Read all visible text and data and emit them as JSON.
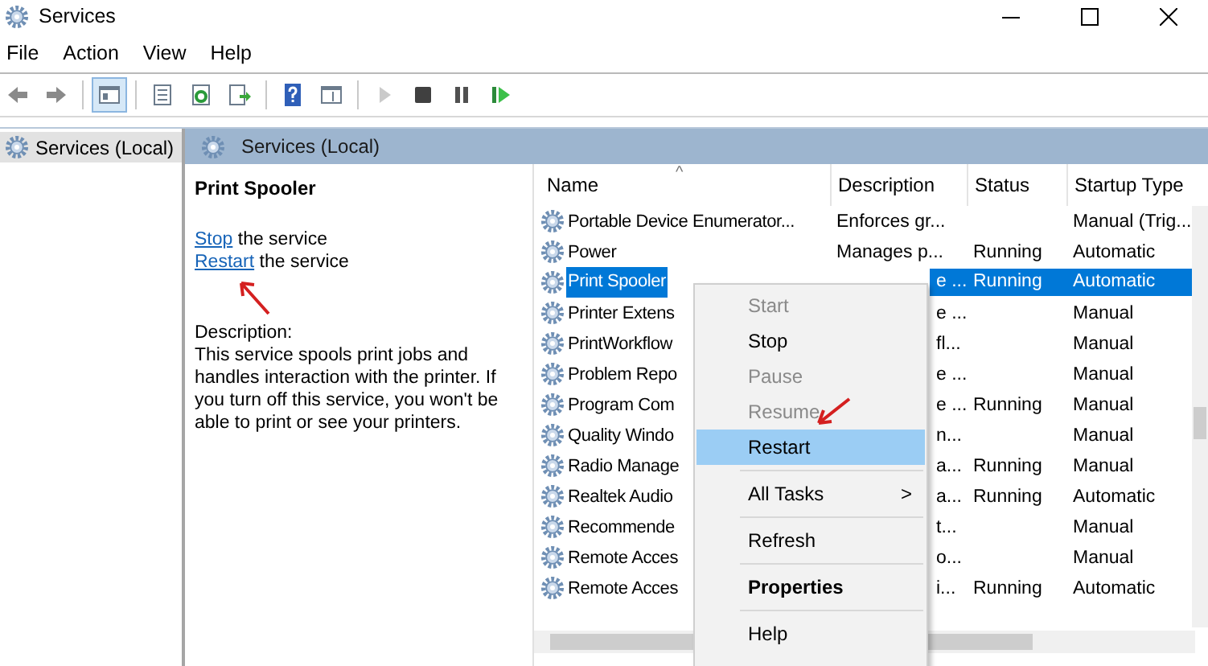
{
  "window": {
    "title": "Services"
  },
  "menu_bar": [
    {
      "label": "File"
    },
    {
      "label": "Action"
    },
    {
      "label": "View"
    },
    {
      "label": "Help"
    }
  ],
  "toolbar": [
    {
      "kind": "back"
    },
    {
      "kind": "forward"
    },
    {
      "kind": "separator"
    },
    {
      "kind": "console_tree",
      "selected": true
    },
    {
      "kind": "separator"
    },
    {
      "kind": "properties",
      "selected": false
    },
    {
      "kind": "refresh",
      "selected": false
    },
    {
      "kind": "export",
      "selected": false
    },
    {
      "kind": "separator"
    },
    {
      "kind": "help",
      "selected": false
    },
    {
      "kind": "view",
      "selected": false
    },
    {
      "kind": "separator"
    },
    {
      "kind": "start",
      "disabled": true
    },
    {
      "kind": "stop",
      "disabled": false
    },
    {
      "kind": "pause",
      "disabled": false
    },
    {
      "kind": "resume",
      "disabled": false
    }
  ],
  "tree": [
    {
      "label": "Services (Local)",
      "selected": true
    }
  ],
  "pane_header": {
    "title": "Services (Local)"
  },
  "details": {
    "title": "Print Spooler",
    "actions": [
      {
        "link": "Stop",
        "text": "the service"
      },
      {
        "link": "Restart",
        "text": "the service"
      }
    ],
    "description_label": "Description:",
    "description": "This service spools print jobs and handles interaction with the printer. If you turn off this service, you won't be able to print or see your printers."
  },
  "table": {
    "columns": [
      {
        "label": "Name",
        "sort_mark": "^"
      },
      {
        "label": "Description"
      },
      {
        "label": "Status"
      },
      {
        "label": "Startup Type"
      }
    ],
    "rows": [
      {
        "name": "Portable Device Enumerator...",
        "description": "Enforces gr...",
        "status": "",
        "startup_type": "Manual (Trig...",
        "selected": false
      },
      {
        "name": "Power",
        "description": "Manages p...",
        "status": "Running",
        "startup_type": "Automatic",
        "selected": false
      },
      {
        "name": "Print Spooler",
        "description": "e ...",
        "status": "Running",
        "startup_type": "Automatic",
        "selected": true
      },
      {
        "name": "Printer Extens",
        "description": "e ...",
        "status": "",
        "startup_type": "Manual",
        "selected": false
      },
      {
        "name": "PrintWorkflow",
        "description": "fl...",
        "status": "",
        "startup_type": "Manual",
        "selected": false
      },
      {
        "name": "Problem Repo",
        "description": "e ...",
        "status": "",
        "startup_type": "Manual",
        "selected": false
      },
      {
        "name": "Program Com",
        "description": "e ...",
        "status": "Running",
        "startup_type": "Manual",
        "selected": false
      },
      {
        "name": "Quality Windo",
        "description": "n...",
        "status": "",
        "startup_type": "Manual",
        "selected": false
      },
      {
        "name": "Radio Manage",
        "description": "a...",
        "status": "Running",
        "startup_type": "Manual",
        "selected": false
      },
      {
        "name": "Realtek Audio",
        "description": "a...",
        "status": "Running",
        "startup_type": "Automatic",
        "selected": false
      },
      {
        "name": "Recommende",
        "description": "t...",
        "status": "",
        "startup_type": "Manual",
        "selected": false
      },
      {
        "name": "Remote Acces",
        "description": "o...",
        "status": "",
        "startup_type": "Manual",
        "selected": false
      },
      {
        "name": "Remote Acces",
        "description": "i...",
        "status": "Running",
        "startup_type": "Automatic",
        "selected": false
      }
    ]
  },
  "context_menu": {
    "items": [
      {
        "kind": "item",
        "label": "Start",
        "disabled": true,
        "selected": false
      },
      {
        "kind": "item",
        "label": "Stop",
        "disabled": false,
        "selected": false
      },
      {
        "kind": "item",
        "label": "Pause",
        "disabled": true,
        "selected": false
      },
      {
        "kind": "item",
        "label": "Resume",
        "disabled": true,
        "selected": false
      },
      {
        "kind": "item",
        "label": "Restart",
        "disabled": false,
        "selected": true
      },
      {
        "kind": "separator"
      },
      {
        "kind": "submenu",
        "label": "All Tasks",
        "arrow": ">",
        "disabled": false,
        "selected": false
      },
      {
        "kind": "separator"
      },
      {
        "kind": "item",
        "label": "Refresh",
        "disabled": false,
        "selected": false
      },
      {
        "kind": "separator"
      },
      {
        "kind": "item",
        "label": "Properties",
        "disabled": false,
        "selected": false,
        "default": true
      },
      {
        "kind": "separator"
      },
      {
        "kind": "item",
        "label": "Help",
        "disabled": false,
        "selected": false
      }
    ]
  }
}
